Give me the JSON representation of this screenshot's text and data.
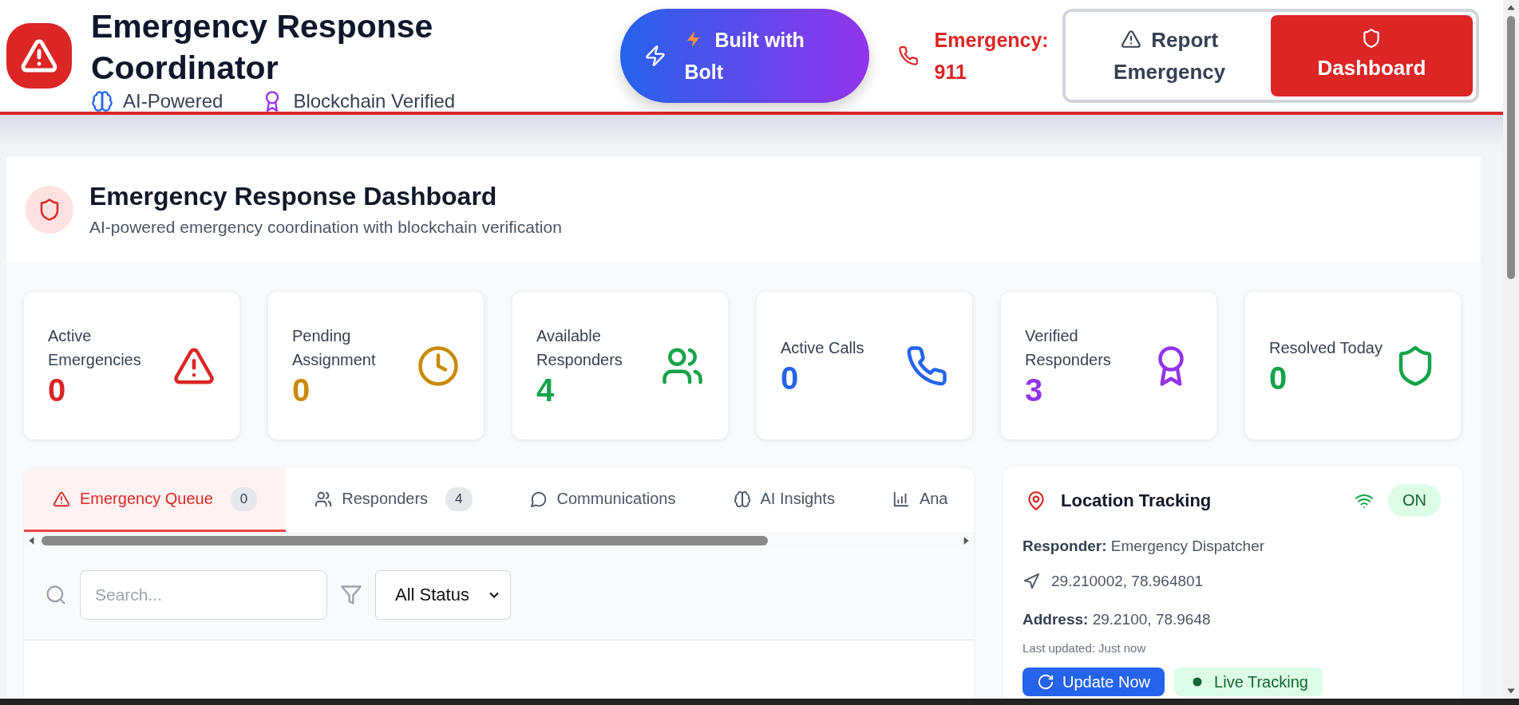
{
  "header": {
    "title": "Emergency Response Coordinator",
    "badges": [
      {
        "label": "AI-Powered",
        "kind": "brain"
      },
      {
        "label": "Blockchain Verified",
        "kind": "award"
      }
    ],
    "bolt_button": "Built with Bolt",
    "hotline": "Emergency: 911",
    "nav": [
      {
        "label": "Report Emergency",
        "kind": "alert",
        "selected": false
      },
      {
        "label": "Dashboard",
        "kind": "shield",
        "selected": true
      }
    ]
  },
  "dashboard": {
    "title": "Emergency Response Dashboard",
    "subtitle": "AI-powered emergency coordination with blockchain verification"
  },
  "stats": [
    {
      "label": "Active Emergencies",
      "value": "0",
      "kind": "alert",
      "color": "#dc2626"
    },
    {
      "label": "Pending Assignment",
      "value": "0",
      "kind": "clock",
      "color": "#ca8a04"
    },
    {
      "label": "Available Responders",
      "value": "4",
      "kind": "users",
      "color": "#16a34a"
    },
    {
      "label": "Active Calls",
      "value": "0",
      "kind": "phone",
      "color": "#2563eb"
    },
    {
      "label": "Verified Responders",
      "value": "3",
      "kind": "award",
      "color": "#9333ea"
    },
    {
      "label": "Resolved Today",
      "value": "0",
      "kind": "shield",
      "color": "#16a34a"
    }
  ],
  "tabs": [
    {
      "label": "Emergency Queue",
      "count": "0",
      "kind": "alert",
      "selected": true
    },
    {
      "label": "Responders",
      "count": "4",
      "kind": "users",
      "selected": false
    },
    {
      "label": "Communications",
      "kind": "message",
      "selected": false
    },
    {
      "label": "AI Insights",
      "kind": "brain",
      "selected": false
    },
    {
      "label": "Ana",
      "kind": "chart",
      "selected": false
    }
  ],
  "search": {
    "placeholder": "Search..."
  },
  "status_filter": "All Status",
  "location": {
    "title": "Location Tracking",
    "status": "ON",
    "on": true,
    "responder": "**Responder:** Emergency Dispatcher",
    "coordinates": "29.210002, 78.964801",
    "address": "**Address:** 29.2100, 78.9648",
    "updated": "Last updated: Just now",
    "buttons": [
      {
        "label": "Update Now",
        "kind": "refresh"
      },
      {
        "label": "Live Tracking",
        "kind": "live"
      }
    ]
  }
}
